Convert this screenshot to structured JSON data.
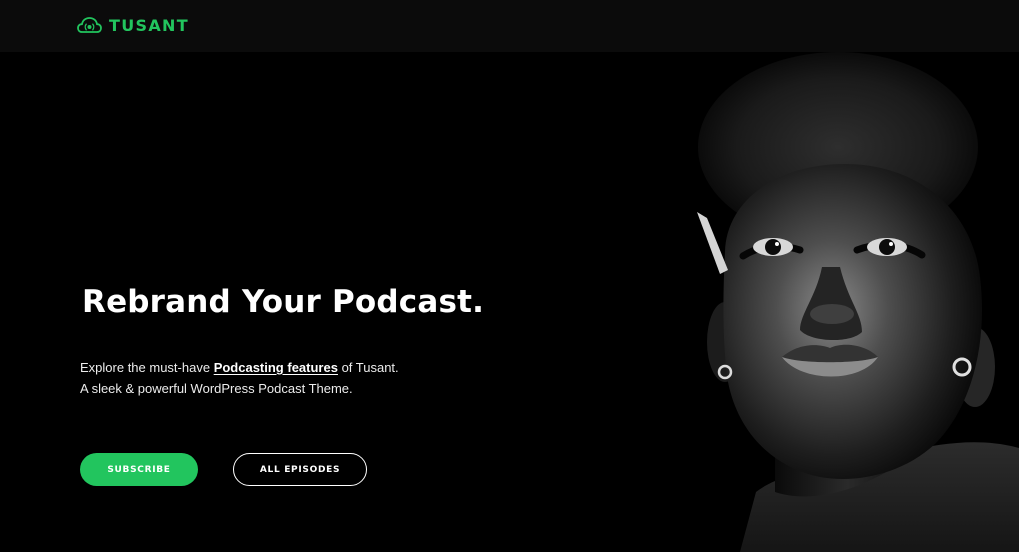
{
  "brand": {
    "name": "TUSANT",
    "logo_icon": "podcast-cloud-icon",
    "accent_color": "#22c55e"
  },
  "hero": {
    "headline": "Rebrand Your Podcast.",
    "description": {
      "line1_prefix": "Explore the must-have ",
      "line1_link": "Podcasting features",
      "line1_suffix": " of Tusant.",
      "line2": "A sleek & powerful WordPress Podcast Theme."
    },
    "buttons": {
      "subscribe": "SUBSCRIBE",
      "all_episodes": "ALL EPISODES"
    },
    "image": "black-and-white-portrait"
  }
}
